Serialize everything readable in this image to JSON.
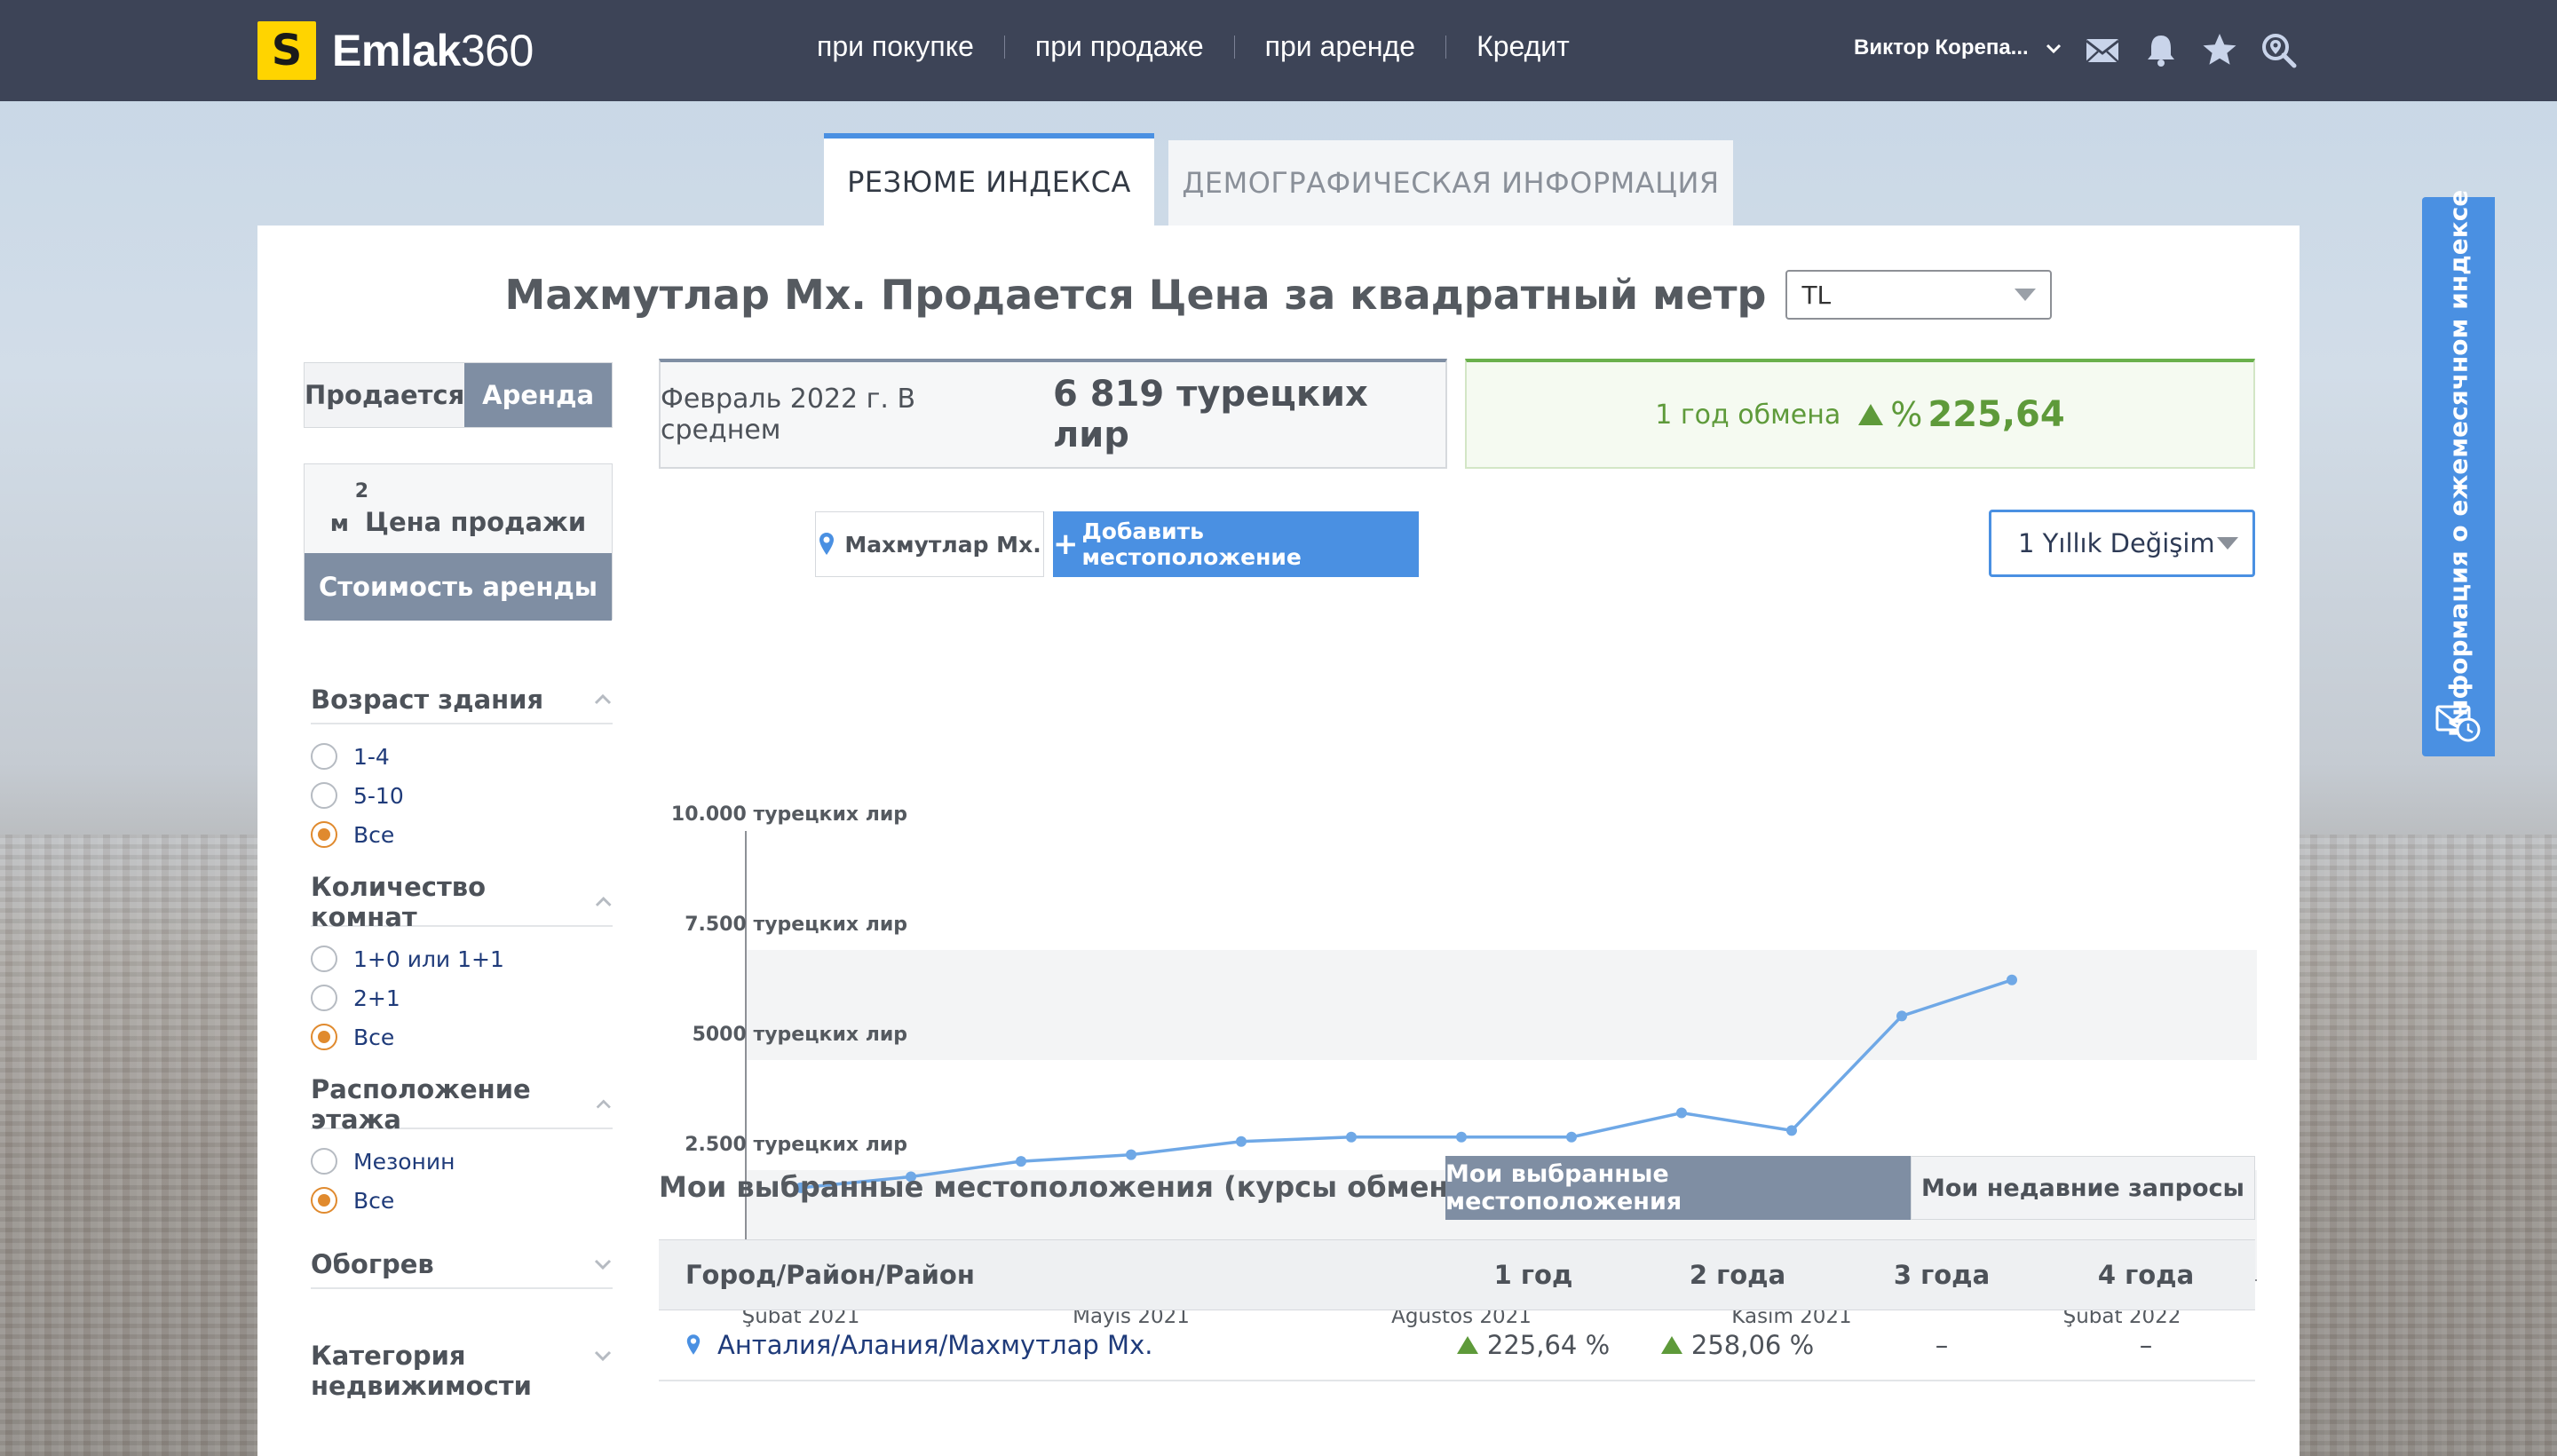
{
  "header": {
    "logo_letter": "S",
    "logo_brand": "Emlak",
    "logo_number": "360",
    "nav": [
      "при покупке",
      "при продаже",
      "при аренде",
      "Кредит"
    ],
    "user_name": "Виктор Корепа...",
    "icons": [
      "mail-icon",
      "bell-icon",
      "star-icon",
      "search-location-icon"
    ]
  },
  "tabs": {
    "active": "РЕЗЮМЕ ИНДЕКСА",
    "inactive": "ДЕМОГРАФИЧЕСКАЯ ИНФОРМАЦИЯ"
  },
  "title": {
    "text": "Махмутлар Мх. Продается Цена за квадратный метр",
    "currency": "TL"
  },
  "sidebar": {
    "segment": {
      "sale": "Продается",
      "rent": "Аренда",
      "selected": "rent"
    },
    "price": {
      "unit": "м",
      "unit_sup": "2",
      "sale_label": "Цена продажи",
      "rent_label": "Стоимость аренды"
    },
    "filters": [
      {
        "title": "Возраст здания",
        "expanded": true,
        "options": [
          {
            "label": "1-4",
            "selected": false
          },
          {
            "label": "5-10",
            "selected": false
          },
          {
            "label": "Все",
            "selected": true
          }
        ]
      },
      {
        "title": "Количество комнат",
        "expanded": true,
        "options": [
          {
            "label": "1+0 или 1+1",
            "selected": false
          },
          {
            "label": "2+1",
            "selected": false
          },
          {
            "label": "Все",
            "selected": true
          }
        ]
      },
      {
        "title": "Расположение этажа",
        "expanded": true,
        "options": [
          {
            "label": "Мезонин",
            "selected": false
          },
          {
            "label": "Все",
            "selected": true
          }
        ]
      },
      {
        "title": "Обогрев",
        "expanded": false,
        "options": []
      },
      {
        "title": "Категория недвижимости",
        "expanded": false,
        "options": []
      }
    ]
  },
  "summary": {
    "avg_label": "Февраль 2022 г. В среднем",
    "avg_value": "6 819 турецких лир",
    "change_label": "1 год обмена",
    "change_symbol": "%",
    "change_value": "225,64"
  },
  "chart_controls": {
    "location": "Махмутлар Мх.",
    "add_button": "Добавить местоположение",
    "period": "1 Yıllık Değişim"
  },
  "chart_data": {
    "type": "line",
    "ylim": [
      0,
      10000
    ],
    "y_ticks": [
      "0",
      "2.500 турецких лир",
      "5000 турецких лир",
      "7.500 турецких лир",
      "10.000 турецких лир"
    ],
    "x_tick_labels": [
      "Şubat 2021",
      "Mayıs 2021",
      "Ağustos 2021",
      "Kasım 2021",
      "Şubat 2022"
    ],
    "x_tick_index": [
      0,
      3,
      6,
      9,
      12
    ],
    "series": [
      {
        "values": [
          2100,
          2350,
          2700,
          2850,
          3150,
          3250,
          3250,
          3250,
          3800,
          3400,
          6000,
          6819
        ]
      }
    ],
    "grid_bands": true,
    "line_color": "#6fa8e6"
  },
  "chart_extra": {
    "last_value": 6819
  },
  "favorites": {
    "title": "Мои выбранные местоположения (курсы обмена)",
    "tab_on": "Мои выбранные местоположения",
    "tab_off": "Мои недавние запросы",
    "columns": [
      "Город/Район/Район",
      "1 год",
      "2 года",
      "3 года",
      "4 года"
    ],
    "rows": [
      {
        "location": "Анталия/Алания/Махмутлар Мх.",
        "y1": "225,64 %",
        "y2": "258,06 %",
        "y3": "–",
        "y4": "–"
      }
    ]
  },
  "side_tab": {
    "label": "Информация о ежемесячном индексе"
  }
}
